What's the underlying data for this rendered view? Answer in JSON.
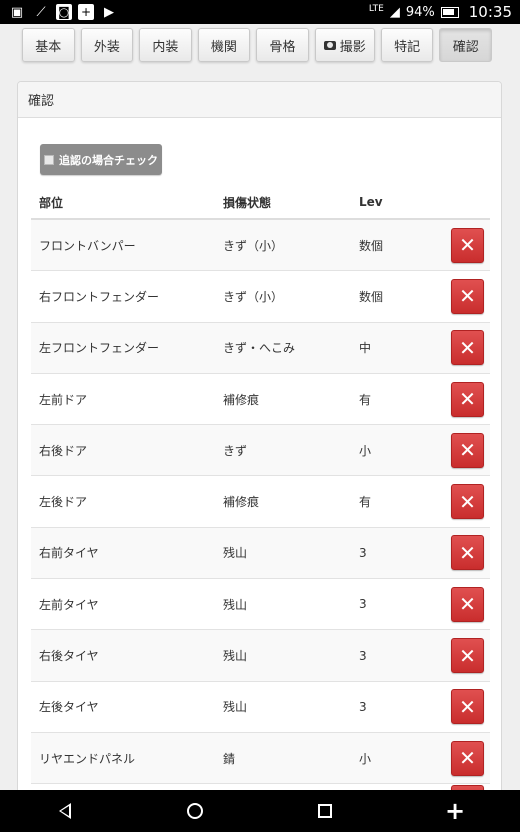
{
  "status_bar": {
    "battery_pct": "94%",
    "time": "10:35",
    "network": "LTE"
  },
  "tabs": [
    {
      "label": "基本"
    },
    {
      "label": "外装"
    },
    {
      "label": "内装"
    },
    {
      "label": "機関"
    },
    {
      "label": "骨格"
    },
    {
      "label": "撮影",
      "icon": "camera-icon"
    },
    {
      "label": "特記"
    },
    {
      "label": "確認",
      "active": true
    }
  ],
  "panel": {
    "title": "確認",
    "check_button_label": "追認の場合チェック",
    "columns": [
      "部位",
      "損傷状態",
      "Lev"
    ],
    "rows": [
      {
        "part": "フロントバンパー",
        "damage": "きず（小）",
        "lev": "数個"
      },
      {
        "part": "右フロントフェンダー",
        "damage": "きず（小）",
        "lev": "数個"
      },
      {
        "part": "左フロントフェンダー",
        "damage": "きず・へこみ",
        "lev": "中"
      },
      {
        "part": "左前ドア",
        "damage": "補修痕",
        "lev": "有"
      },
      {
        "part": "右後ドア",
        "damage": "きず",
        "lev": "小"
      },
      {
        "part": "左後ドア",
        "damage": "補修痕",
        "lev": "有"
      },
      {
        "part": "右前タイヤ",
        "damage": "残山",
        "lev": "3"
      },
      {
        "part": "左前タイヤ",
        "damage": "残山",
        "lev": "3"
      },
      {
        "part": "右後タイヤ",
        "damage": "残山",
        "lev": "3"
      },
      {
        "part": "左後タイヤ",
        "damage": "残山",
        "lev": "3"
      },
      {
        "part": "リヤエンドパネル",
        "damage": "錆",
        "lev": "小"
      }
    ],
    "delete_glyph": "✕"
  }
}
